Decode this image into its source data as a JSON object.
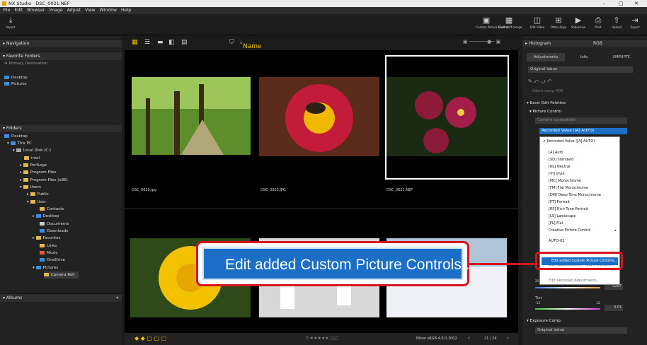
{
  "window": {
    "app_name": "NX Studio",
    "file": "DSC_0021.NEF",
    "controls": [
      "–",
      "□",
      "✕"
    ]
  },
  "menu": [
    "File",
    "Edit",
    "Browser",
    "Image",
    "Adjust",
    "View",
    "Window",
    "Help"
  ],
  "toolbar": {
    "import_label": "Import",
    "right_buttons": [
      "Custom Picture Control",
      "Pixel shift merge",
      "Edit Video",
      "Other Apps",
      "Slideshow",
      "Print",
      "Upload",
      "Export"
    ]
  },
  "left_panel": {
    "navigation": "Navigation",
    "favorite_folders": "Favorite Folders",
    "primary_destination": "Primary Destination",
    "favorites": [
      "Desktop",
      "Pictures"
    ],
    "folders": "Folders",
    "albums": "Albums",
    "tree": [
      "Desktop",
      "This PC",
      "Local Disk (C:)",
      "intel",
      "PerfLogs",
      "Program Files",
      "Program Files (x86)",
      "Users",
      "Public",
      "User",
      "Contacts",
      "Desktop",
      "Documents",
      "Downloads",
      "Favorites",
      "Links",
      "Music",
      "OneDrive",
      "Pictures",
      "Camera Roll"
    ]
  },
  "center": {
    "sort_label": "Name",
    "thumbnails": [
      {
        "caption": "DSC_0019.jpg"
      },
      {
        "caption": "DSC_0020.JPG"
      },
      {
        "caption": "DSC_0021.NEF"
      }
    ],
    "status": {
      "profile": "Nikon sRGB 4.0.0.3002",
      "page": "21 / 24"
    }
  },
  "right_panel": {
    "histogram": "Histogram",
    "histogram_mode": "RGB",
    "tabs": [
      "Adjustments",
      "Info",
      "XMP/IPTC"
    ],
    "original_value": "Original Value",
    "adjust_hdr": "Adjust using HDR",
    "basic_edit_palettes": "Basic Edit Palettes",
    "picture_control": "Picture Control",
    "camera_compatible": "Camera compatible",
    "selected": "Recorded Value ([A] AUTO)",
    "exposure_comp": "Exposure Comp.",
    "exposure_value": "Original Value",
    "tint": "Tint",
    "temp_min": "2500K",
    "temp_max": "10000K",
    "temp_value": "5207",
    "tint_min": "-12",
    "tint_max": "12",
    "tint_value": "0.01"
  },
  "dropdown_menu": [
    "Recorded Value ([A] AUTO)",
    "[A] Auto",
    "[SD] Standard",
    "[NL] Neutral",
    "[VI] Vivid",
    "[MC] Monochrome",
    "[FM] Flat Monochrome",
    "[DM] Deep Tone Monochrome",
    "[PT] Portrait",
    "[RP] Rich Tone Portrait",
    "[LS] Landscape",
    "[FL] Flat",
    "Creative Picture Control",
    "AUTO-02",
    "Edit added Custom Picture Controls...",
    "Edit Recorded Adjustments..."
  ],
  "callout": {
    "label": "Edit added Custom Picture Controls..."
  },
  "colors": {
    "accent": "#1b6fc7",
    "highlight_border": "#d8141e",
    "folder": "#e6b84b"
  }
}
